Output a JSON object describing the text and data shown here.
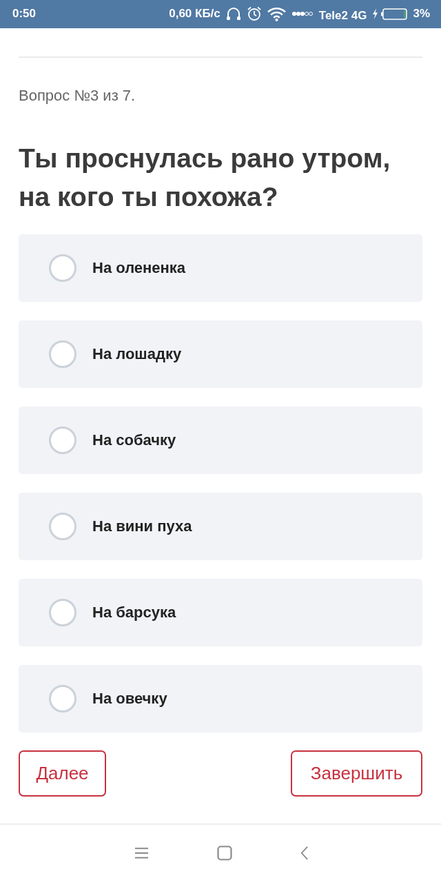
{
  "status_bar": {
    "time": "0:50",
    "speed": "0,60 КБ/с",
    "carrier": "Tele2 4G",
    "battery": "3%"
  },
  "progress_label": "Вопрос №3 из 7.",
  "question": "Ты проснулась рано утром, на кого ты похожа?",
  "options": [
    {
      "label": "На олененка",
      "selected": false
    },
    {
      "label": "На лошадку",
      "selected": false
    },
    {
      "label": "На собачку",
      "selected": false
    },
    {
      "label": "На вини пуха",
      "selected": false
    },
    {
      "label": "На барсука",
      "selected": false
    },
    {
      "label": "На овечку",
      "selected": false
    }
  ],
  "buttons": [
    {
      "label": "Далее",
      "kind": "next"
    },
    {
      "label": "Завершить",
      "kind": "finish"
    }
  ]
}
